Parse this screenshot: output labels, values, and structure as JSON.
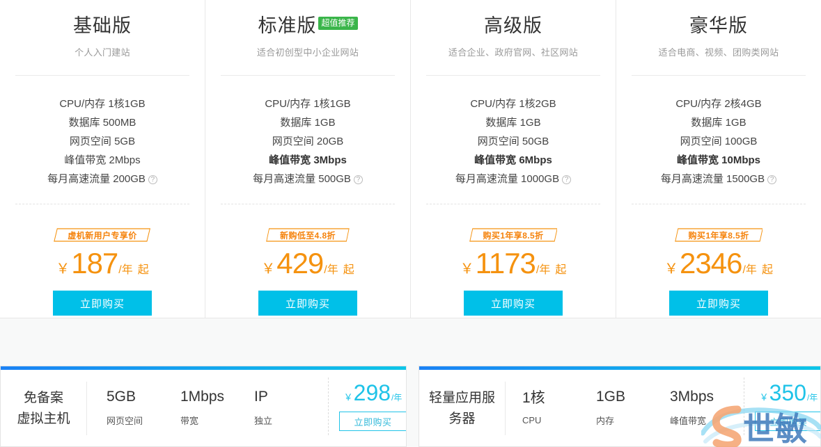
{
  "plans": [
    {
      "title": "基础版",
      "badge": "",
      "subtitle": "个人入门建站",
      "specs": [
        {
          "text": "CPU/内存 1核1GB",
          "bold": false,
          "help": false
        },
        {
          "text": "数据库 500MB",
          "bold": false,
          "help": false
        },
        {
          "text": "网页空间 5GB",
          "bold": false,
          "help": false
        },
        {
          "text": "峰值带宽 2Mbps",
          "bold": false,
          "help": false
        },
        {
          "text": "每月高速流量 200GB",
          "bold": false,
          "help": true
        }
      ],
      "promo": "虚机新用户专享价",
      "currency": "￥",
      "price": "187",
      "unit": "/年",
      "suffix": "起",
      "buy_label": "立即购买"
    },
    {
      "title": "标准版",
      "badge": "超值推荐",
      "subtitle": "适合初创型中小企业网站",
      "specs": [
        {
          "text": "CPU/内存 1核1GB",
          "bold": false,
          "help": false
        },
        {
          "text": "数据库 1GB",
          "bold": false,
          "help": false
        },
        {
          "text": "网页空间 20GB",
          "bold": false,
          "help": false
        },
        {
          "text": "峰值带宽 3Mbps",
          "bold": true,
          "help": false
        },
        {
          "text": "每月高速流量 500GB",
          "bold": false,
          "help": true
        }
      ],
      "promo": "新购低至4.8折",
      "currency": "￥",
      "price": "429",
      "unit": "/年",
      "suffix": "起",
      "buy_label": "立即购买"
    },
    {
      "title": "高级版",
      "badge": "",
      "subtitle": "适合企业、政府官网、社区网站",
      "specs": [
        {
          "text": "CPU/内存 1核2GB",
          "bold": false,
          "help": false
        },
        {
          "text": "数据库 1GB",
          "bold": false,
          "help": false
        },
        {
          "text": "网页空间 50GB",
          "bold": false,
          "help": false
        },
        {
          "text": "峰值带宽 6Mbps",
          "bold": true,
          "help": false
        },
        {
          "text": "每月高速流量 1000GB",
          "bold": false,
          "help": true
        }
      ],
      "promo": "购买1年享8.5折",
      "currency": "￥",
      "price": "1173",
      "unit": "/年",
      "suffix": "起",
      "buy_label": "立即购买"
    },
    {
      "title": "豪华版",
      "badge": "",
      "subtitle": "适合电商、视频、团购类网站",
      "specs": [
        {
          "text": "CPU/内存 2核4GB",
          "bold": false,
          "help": false
        },
        {
          "text": "数据库 1GB",
          "bold": false,
          "help": false
        },
        {
          "text": "网页空间 100GB",
          "bold": false,
          "help": false
        },
        {
          "text": "峰值带宽 10Mbps",
          "bold": true,
          "help": false
        },
        {
          "text": "每月高速流量 1500GB",
          "bold": false,
          "help": true
        }
      ],
      "promo": "购买1年享8.5折",
      "currency": "￥",
      "price": "2346",
      "unit": "/年",
      "suffix": "起",
      "buy_label": "立即购买"
    }
  ],
  "mini_panels": [
    {
      "name": "免备案\n虚拟主机",
      "name_line1": "免备案",
      "name_line2": "虚拟主机",
      "specs": [
        {
          "value": "5GB",
          "label": "网页空间"
        },
        {
          "value": "1Mbps",
          "label": "带宽"
        },
        {
          "value": "IP",
          "label": "独立"
        }
      ],
      "currency": "￥",
      "price": "298",
      "unit": "/年",
      "buy_label": "立即购买"
    },
    {
      "name_line1": "轻量应用服",
      "name_line2": "务器",
      "specs": [
        {
          "value": "1核",
          "label": "CPU"
        },
        {
          "value": "1GB",
          "label": "内存"
        },
        {
          "value": "3Mbps",
          "label": "峰值带宽"
        }
      ],
      "currency": "￥",
      "price": "350",
      "unit": "/年",
      "buy_label": "立即购买"
    }
  ],
  "icons": {
    "help": "?"
  },
  "colors": {
    "accent_cyan": "#00c0e8",
    "price_orange": "#f5920f",
    "badge_green": "#3ab54a",
    "panel_bar_blue": "#1b82f5",
    "panel_bar_cyan": "#0ec5e8"
  }
}
